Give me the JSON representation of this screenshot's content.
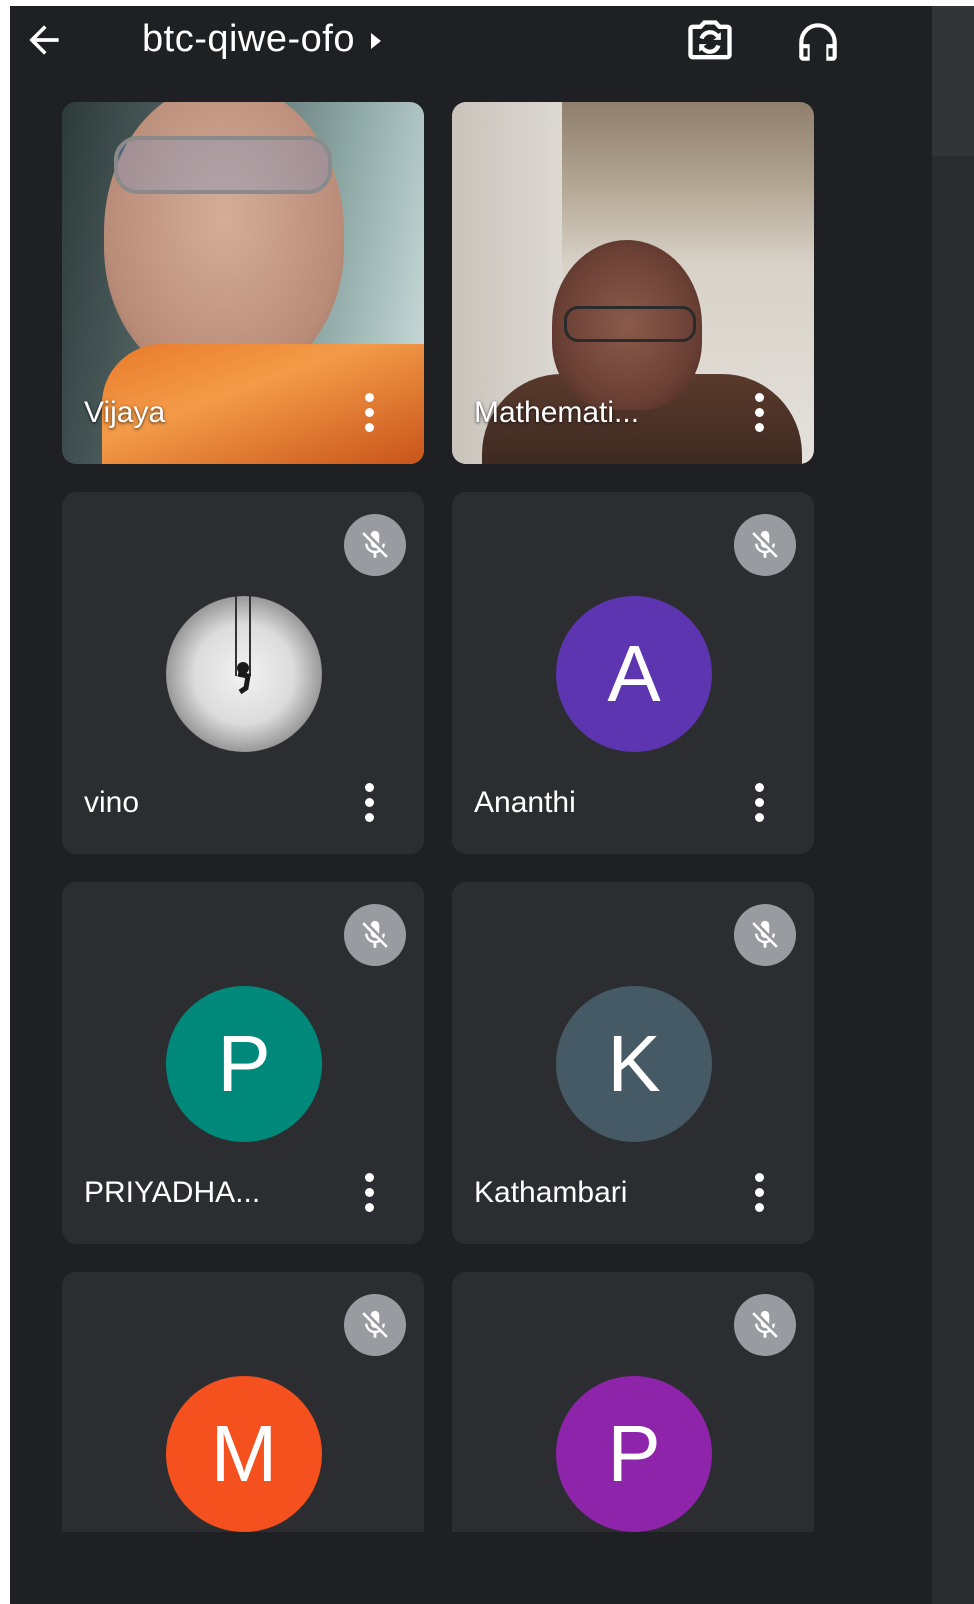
{
  "meeting": {
    "code": "btc-qiwe-ofo"
  },
  "icons": {
    "back": "arrow-left-icon",
    "caret": "caret-right-icon",
    "switch_camera": "switch-camera-icon",
    "audio": "headphones-icon",
    "more": "more-vertical-icon",
    "muted": "mic-off-icon"
  },
  "participants": [
    {
      "name": "Vijaya",
      "type": "video"
    },
    {
      "name": "Mathemati...",
      "type": "video"
    },
    {
      "name": "vino",
      "type": "photo-avatar",
      "muted": true
    },
    {
      "name": "Ananthi",
      "initial": "A",
      "avatar_color": "#5e35b1",
      "muted": true
    },
    {
      "name": "PRIYADHA...",
      "initial": "P",
      "avatar_color": "#00897b",
      "muted": true
    },
    {
      "name": "Kathambari",
      "initial": "K",
      "avatar_color": "#455a64",
      "muted": true
    },
    {
      "name": "",
      "initial": "M",
      "avatar_color": "#f4511e",
      "muted": true
    },
    {
      "name": "",
      "initial": "P",
      "avatar_color": "#8e24aa",
      "muted": true
    }
  ]
}
